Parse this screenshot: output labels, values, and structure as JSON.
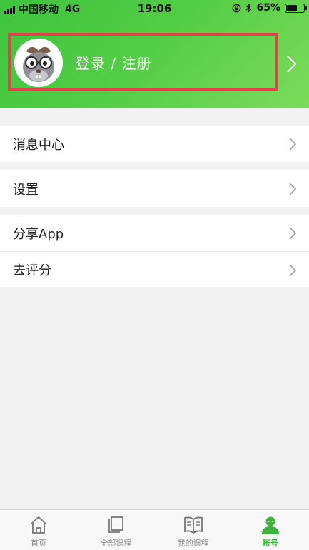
{
  "status_bar": {
    "carrier": "中国移动",
    "network": "4G",
    "time": "19:06",
    "battery": "65%",
    "battery_level": 0.65
  },
  "header": {
    "login_label": "登录 / 注册",
    "avatar_icon": "mascot-avatar-icon",
    "highlight_color": "#ea3f4a"
  },
  "menu": {
    "groups": [
      [
        {
          "label": "消息中心"
        }
      ],
      [
        {
          "label": "设置"
        }
      ],
      [
        {
          "label": "分享App"
        },
        {
          "label": "去评分"
        }
      ]
    ]
  },
  "tabbar": {
    "active_color": "#3cb43c",
    "tabs": [
      {
        "label": "首页",
        "icon": "home-icon"
      },
      {
        "label": "全部课程",
        "icon": "all-courses-icon"
      },
      {
        "label": "我的课程",
        "icon": "my-courses-icon"
      },
      {
        "label": "账号",
        "icon": "account-icon",
        "active": true
      }
    ]
  }
}
